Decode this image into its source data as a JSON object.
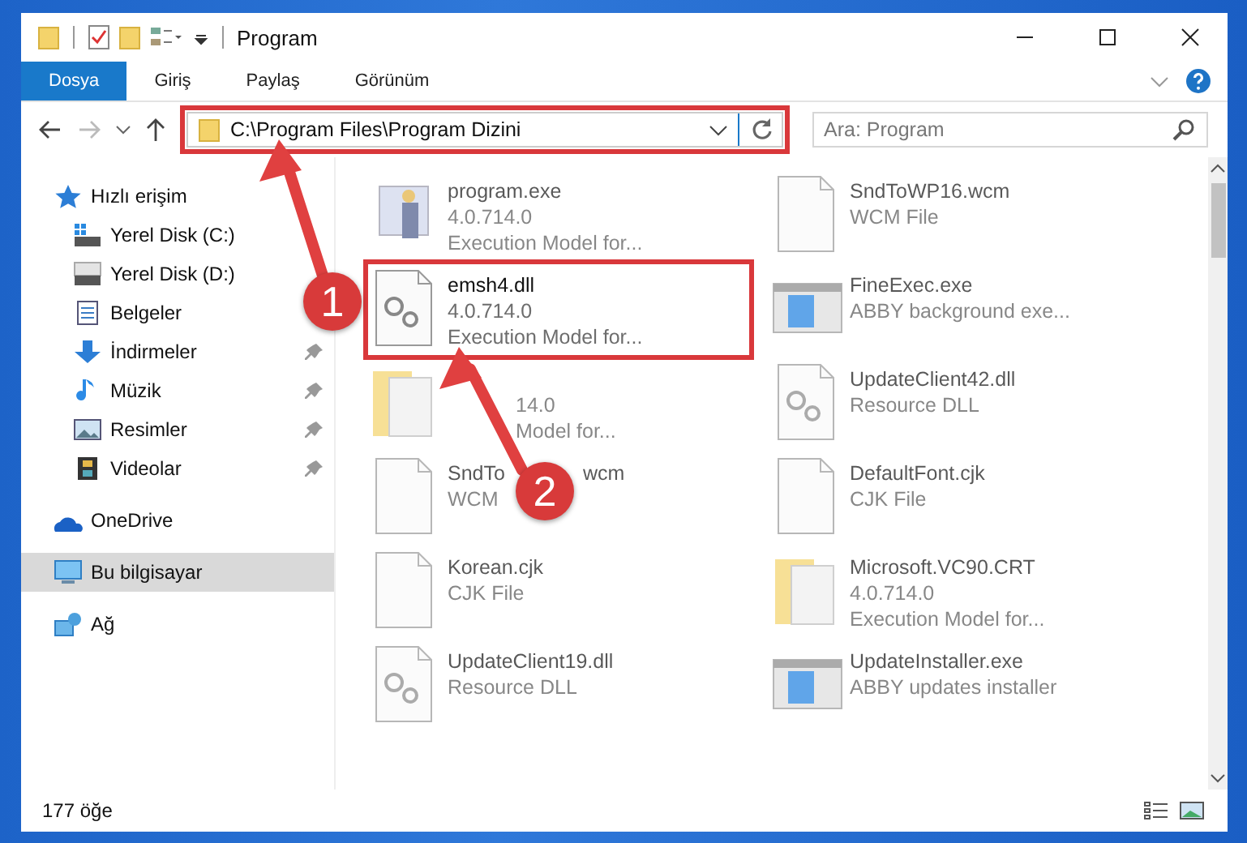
{
  "window": {
    "title": "Program"
  },
  "ribbon_tabs": [
    {
      "label": "Dosya",
      "selected": true
    },
    {
      "label": "Giriş",
      "selected": false
    },
    {
      "label": "Paylaş",
      "selected": false
    },
    {
      "label": "Görünüm",
      "selected": false
    }
  ],
  "address_bar": {
    "path": "C:\\Program Files\\Program Dizini",
    "outlined": true
  },
  "search": {
    "placeholder": "Ara: Program"
  },
  "sidebar": {
    "items": [
      {
        "label": "Hızlı erişim",
        "kind": "star",
        "selected": false,
        "children": [
          {
            "label": "Yerel Disk (C:)",
            "kind": "drive-win",
            "selected": false,
            "pinned": false
          },
          {
            "label": "Yerel Disk (D:)",
            "kind": "drive",
            "selected": false,
            "pinned": false
          },
          {
            "label": "Belgeler",
            "kind": "docs",
            "selected": false,
            "pinned": false
          },
          {
            "label": "İndirmeler",
            "kind": "download",
            "selected": false,
            "pinned": true
          },
          {
            "label": "Müzik",
            "kind": "music",
            "selected": false,
            "pinned": true
          },
          {
            "label": "Resimler",
            "kind": "pictures",
            "selected": false,
            "pinned": true
          },
          {
            "label": "Videolar",
            "kind": "videos",
            "selected": false,
            "pinned": true
          }
        ]
      },
      {
        "label": "OneDrive",
        "kind": "cloud",
        "selected": false
      },
      {
        "label": "Bu bilgisayar",
        "kind": "pc",
        "selected": true
      },
      {
        "label": "Ağ",
        "kind": "network",
        "selected": false
      }
    ]
  },
  "files": [
    {
      "name": "program.exe",
      "lines": [
        "4.0.714.0",
        "Execution Model for..."
      ],
      "kind": "exe",
      "dimmed": true,
      "outlined": false
    },
    {
      "name": "SndToWP16.wcm",
      "lines": [
        "WCM File"
      ],
      "kind": "doc",
      "dimmed": true,
      "outlined": false
    },
    {
      "name": "emsh4.dll",
      "lines": [
        "4.0.714.0",
        "Execution Model for..."
      ],
      "kind": "dll",
      "dimmed": false,
      "outlined": true
    },
    {
      "name": "FineExec.exe",
      "lines": [
        "ABBY background exe..."
      ],
      "kind": "app",
      "dimmed": true,
      "outlined": false
    },
    {
      "lines": [
        "14.0",
        "Model for..."
      ],
      "kind": "folder",
      "dimmed": true,
      "outlined": false
    },
    {
      "name": "UpdateClient42.dll",
      "lines": [
        "Resource DLL"
      ],
      "kind": "dll",
      "dimmed": true,
      "outlined": false
    },
    {
      "name": "SndTo",
      "name_after": "wcm",
      "lines": [
        "WCM"
      ],
      "kind": "doc",
      "dimmed": true,
      "outlined": false
    },
    {
      "name": "DefaultFont.cjk",
      "lines": [
        "CJK File"
      ],
      "kind": "doc",
      "dimmed": true,
      "outlined": false
    },
    {
      "name": "Korean.cjk",
      "lines": [
        "CJK File"
      ],
      "kind": "doc",
      "dimmed": true,
      "outlined": false
    },
    {
      "name": "Microsoft.VC90.CRT",
      "lines": [
        "4.0.714.0",
        "Execution Model for..."
      ],
      "kind": "folder",
      "dimmed": true,
      "outlined": false
    },
    {
      "name": "UpdateClient19.dll",
      "lines": [
        "Resource DLL"
      ],
      "kind": "dll",
      "dimmed": true,
      "outlined": false
    },
    {
      "name": "UpdateInstaller.exe",
      "lines": [
        "ABBY updates installer"
      ],
      "kind": "app",
      "dimmed": true,
      "outlined": false
    }
  ],
  "status_bar": {
    "item_count": "177 öğe"
  },
  "annotations": [
    {
      "label": "1"
    },
    {
      "label": "2"
    }
  ]
}
